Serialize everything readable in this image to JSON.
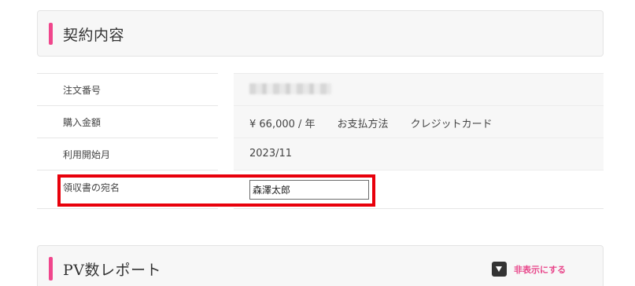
{
  "contract_section": {
    "title": "契約内容"
  },
  "contract_rows": [
    {
      "label": "注文番号",
      "value": ""
    },
    {
      "label": "購入金額",
      "value": "¥ 66,000 / 年",
      "extra_label": "お支払方法",
      "extra_value": "クレジットカード"
    },
    {
      "label": "利用開始月",
      "value": "2023/11"
    },
    {
      "label": "領収書の宛名",
      "input_value": "森澤太郎"
    }
  ],
  "pv_section": {
    "title": "PV数レポート",
    "toggle_label": "非表示にする",
    "toggle_icon": "triangle-down-icon"
  },
  "colors": {
    "accent_pink": "#f0468c",
    "highlight_red": "#e8000b",
    "toggle_pink": "#e8458a"
  }
}
